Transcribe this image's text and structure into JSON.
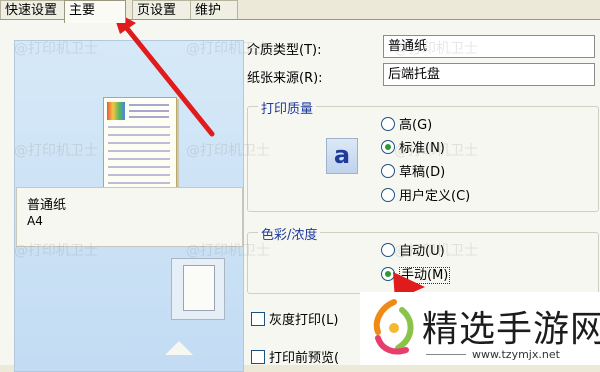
{
  "tabs": [
    {
      "label": "快速设置"
    },
    {
      "label": "主要"
    },
    {
      "label": "页设置"
    },
    {
      "label": "维护"
    }
  ],
  "preview": {
    "paper_name": "普通纸",
    "paper_size": "A4"
  },
  "form": {
    "media_type_label": "介质类型(T):",
    "media_type_value": "普通纸",
    "paper_source_label": "纸张来源(R):",
    "paper_source_value": "后端托盘"
  },
  "print_quality": {
    "title": "打印质量",
    "icon_letter": "a",
    "options": [
      {
        "label": "高(G)",
        "selected": false
      },
      {
        "label": "标准(N)",
        "selected": true
      },
      {
        "label": "草稿(D)",
        "selected": false
      },
      {
        "label": "用户定义(C)",
        "selected": false
      }
    ]
  },
  "color_intensity": {
    "title": "色彩/浓度",
    "options": [
      {
        "label": "自动(U)",
        "selected": false
      },
      {
        "label": "手动(M)",
        "selected": true
      }
    ]
  },
  "checkboxes": [
    {
      "label": "灰度打印(L)",
      "checked": false
    },
    {
      "label": "打印前预览(",
      "checked": false
    }
  ],
  "watermark": "@打印机卫士",
  "logo": {
    "text": "精选手游网",
    "url": "www.tzymjx.net"
  },
  "colors": {
    "arrow": "#e01b1b",
    "group_title": "#1f3b9a"
  }
}
